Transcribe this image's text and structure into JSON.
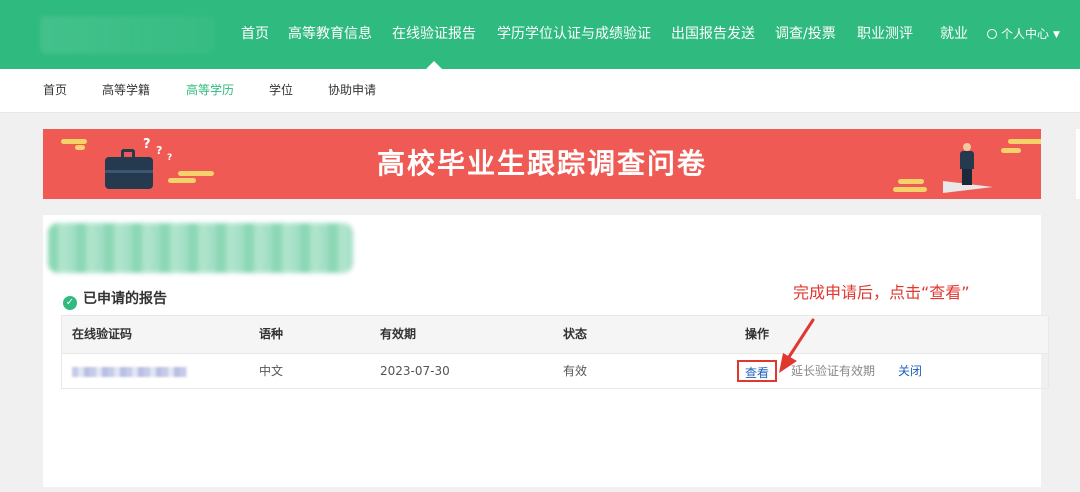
{
  "topnav": {
    "items": [
      {
        "label": "首页"
      },
      {
        "label": "高等教育信息"
      },
      {
        "label": "在线验证报告"
      },
      {
        "label": "学历学位认证与成绩验证"
      },
      {
        "label": "出国报告发送"
      },
      {
        "label": "调查/投票"
      },
      {
        "label": "职业测评"
      },
      {
        "label": "就业"
      }
    ],
    "active_index": 2,
    "user_menu": "个人中心"
  },
  "subnav": {
    "items": [
      {
        "label": "首页"
      },
      {
        "label": "高等学籍"
      },
      {
        "label": "高等学历"
      },
      {
        "label": "学位"
      },
      {
        "label": "协助申请"
      }
    ],
    "active_index": 2
  },
  "banner": {
    "title": "高校毕业生跟踪调查问卷"
  },
  "section": {
    "title": "已申请的报告"
  },
  "annotation": "完成申请后，点击“查看”",
  "table": {
    "headers": [
      "在线验证码",
      "语种",
      "有效期",
      "状态",
      "操作"
    ],
    "rows": [
      {
        "language": "中文",
        "expiry": "2023-07-30",
        "status": "有效",
        "actions": {
          "view": "查看",
          "extend": "延长验证有效期",
          "close": "关闭"
        }
      }
    ]
  },
  "colors": {
    "brand_green": "#2fba7f",
    "banner_red": "#ef5a55",
    "annotation_red": "#e0372f",
    "link_blue": "#1e62b8"
  }
}
